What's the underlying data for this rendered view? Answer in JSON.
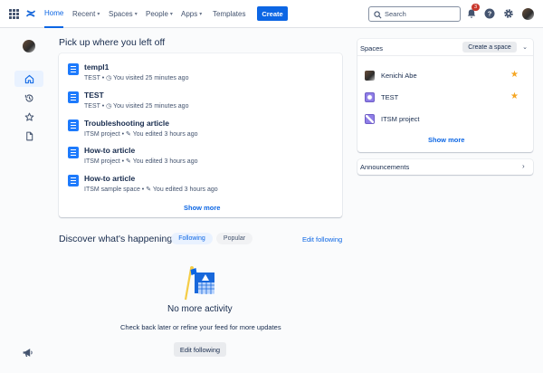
{
  "nav": {
    "home": "Home",
    "recent": "Recent",
    "spaces": "Spaces",
    "people": "People",
    "apps": "Apps",
    "templates": "Templates",
    "create": "Create",
    "search_placeholder": "Search",
    "notification_count": "3"
  },
  "recent": {
    "title": "Pick up where you left off",
    "items": [
      {
        "title": "templ1",
        "space": "TEST",
        "action": "You visited 25 minutes ago",
        "action_icon": "clock-icon"
      },
      {
        "title": "TEST",
        "space": "TEST",
        "action": "You visited 25 minutes ago",
        "action_icon": "clock-icon"
      },
      {
        "title": "Troubleshooting article",
        "space": "ITSM project",
        "action": "You edited 3 hours ago",
        "action_icon": "pencil-icon"
      },
      {
        "title": "How-to article",
        "space": "ITSM project",
        "action": "You edited 3 hours ago",
        "action_icon": "pencil-icon"
      },
      {
        "title": "How-to article",
        "space": "ITSM sample space",
        "action": "You edited 3 hours ago",
        "action_icon": "pencil-icon"
      }
    ],
    "show_more": "Show more"
  },
  "discover": {
    "title": "Discover what's happening",
    "tab_following": "Following",
    "tab_popular": "Popular",
    "edit_following": "Edit following",
    "empty_title": "No more activity",
    "empty_text": "Check back later or refine your feed for more updates",
    "empty_button": "Edit following"
  },
  "spaces": {
    "title": "Spaces",
    "create": "Create a space",
    "items": [
      {
        "name": "Kenichi Abe",
        "starred": true
      },
      {
        "name": "TEST",
        "starred": true
      },
      {
        "name": "ITSM project",
        "starred": false
      }
    ],
    "show_more": "Show more"
  },
  "announcements": {
    "title": "Announcements"
  },
  "colors": {
    "accent": "#0c66e4",
    "doc_icon": "#1d7afc",
    "star": "#f5a623",
    "badge": "#c9372c"
  }
}
